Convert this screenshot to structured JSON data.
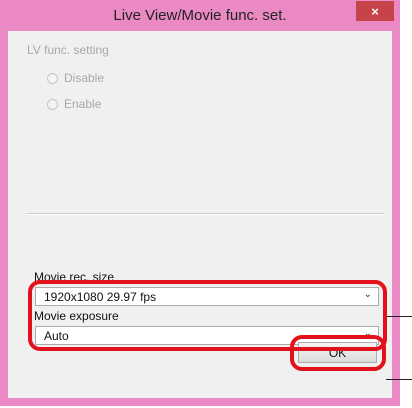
{
  "window": {
    "title": "Live View/Movie func. set.",
    "close_glyph": "×"
  },
  "lv_group": {
    "label": "LV func. setting",
    "options": [
      {
        "label": "Disable",
        "selected": false
      },
      {
        "label": "Enable",
        "selected": false
      }
    ]
  },
  "movie_rec_size": {
    "label": "Movie rec. size",
    "value": "1920x1080  29.97 fps"
  },
  "movie_exposure": {
    "label": "Movie exposure",
    "value": "Auto"
  },
  "ok_button": {
    "label": "OK"
  },
  "icons": {
    "dropdown": "chevron-down-icon",
    "close": "close-icon"
  },
  "colors": {
    "titlebar": "#eb89c5",
    "close_button": "#c7434a",
    "callout": "#e3111b"
  }
}
